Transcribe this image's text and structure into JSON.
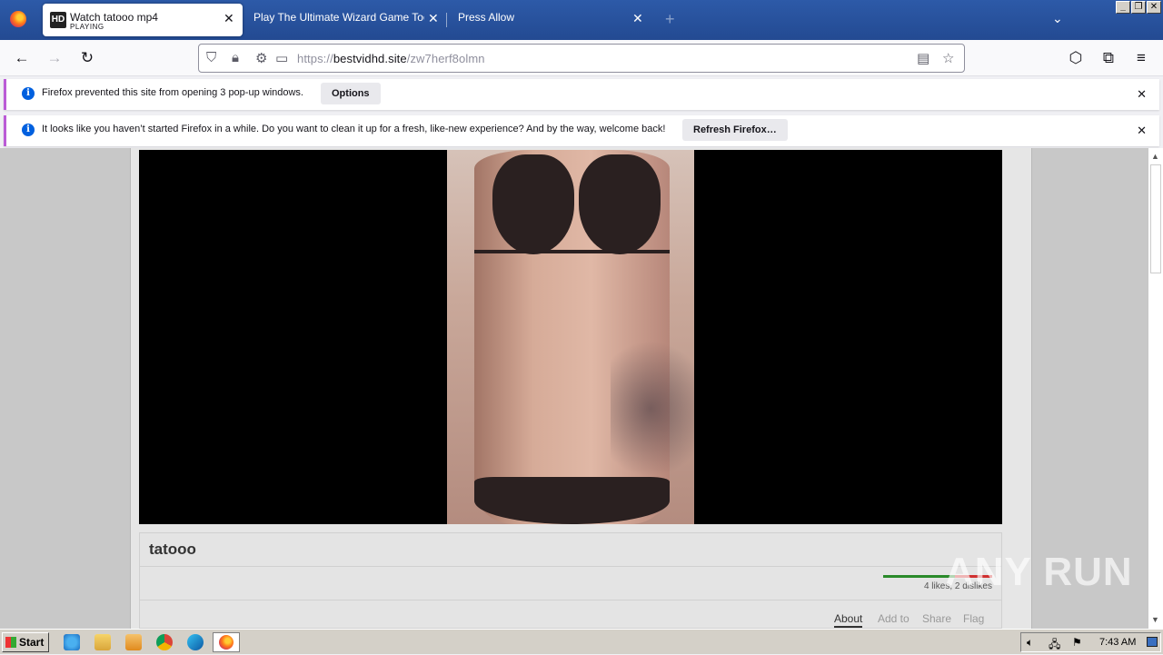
{
  "browser": {
    "tabs": [
      {
        "title": "Watch tatooo mp4",
        "sublabel": "PLAYING",
        "favicon": "HD",
        "active": true
      },
      {
        "title": "Play The Ultimate Wizard Game Today |",
        "active": false
      },
      {
        "title": "Press Allow",
        "active": false
      }
    ],
    "url": {
      "prefix": "https://",
      "host": "bestvidhd.site",
      "path": "/zw7herf8olmn"
    }
  },
  "notifications": [
    {
      "message": "Firefox prevented this site from opening 3 pop-up windows.",
      "button": "Options"
    },
    {
      "message": "It looks like you haven’t started Firefox in a while. Do you want to clean it up for a fresh, like-new experience? And by the way, welcome back!",
      "button": "Refresh Firefox…"
    }
  ],
  "video": {
    "title": "tatooo",
    "likes_text": "4 likes, 2 dislikes",
    "like_ratio": 0.66,
    "tabs": [
      "About",
      "Add to",
      "Share",
      "Flag"
    ]
  },
  "watermark": "ANY RUN",
  "taskbar": {
    "start_label": "Start",
    "clock": "7:43 AM"
  },
  "colors": {
    "tabstrip": "#2d5aa8",
    "notif_accent": "#bb5bd6",
    "info_blue": "#0060df"
  }
}
